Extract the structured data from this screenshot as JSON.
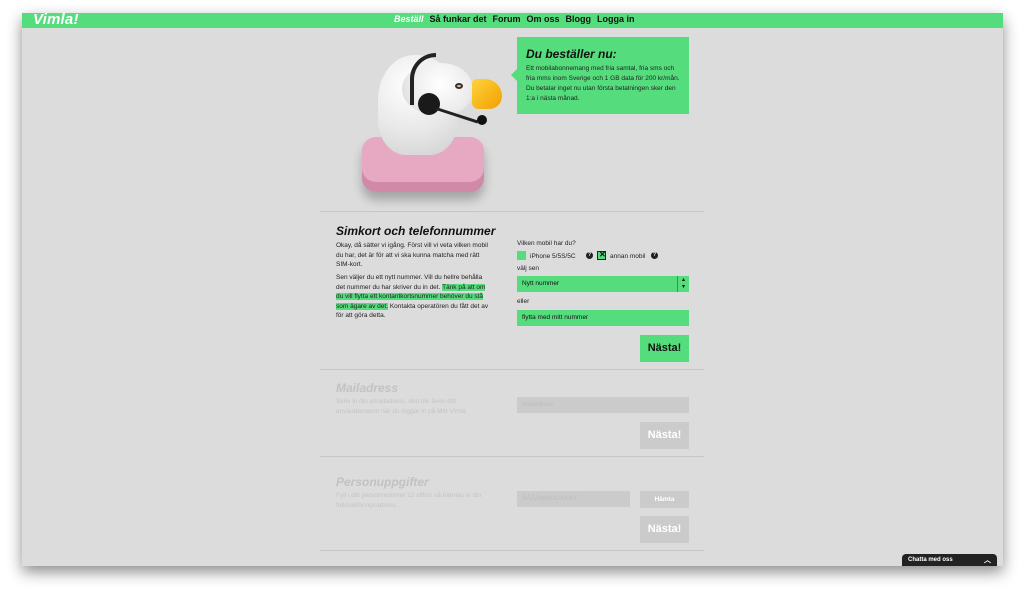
{
  "brand": {
    "logo": "Vimla!",
    "accent": "#55dd7d"
  },
  "nav": {
    "items": [
      "Beställ",
      "Så funkar det",
      "Forum",
      "Om oss",
      "Blogg",
      "Logga in"
    ],
    "active": "Beställ"
  },
  "bubble": {
    "title": "Du beställer nu:",
    "text": "Ett mobilabonnemang med fria samtal, fria sms och fria mms inom Sverige och 1 GB data för 200 kr/mån.  Du betalar inget nu utan första betalningen sker den 1:a i nästa månad."
  },
  "sim": {
    "title": "Simkort och telefonnummer",
    "para1": "Okay, då sätter vi igång. Först vill vi veta vilken mobil du har, det är för att vi ska kunna matcha med rätt SIM-kort.",
    "para2_before": "Sen väljer du ett nytt nummer. Vill du hellre behålla det nummer du har skriver du in det. ",
    "para2_highlight": "Tänk på att om du vill flytta ett kontantkortsnummer behöver du stå som ägare av det.",
    "para2_after": " Kontakta operatören du fått det av för att göra detta.",
    "phone_question": "Vilken mobil har du?",
    "option_iphone": "iPhone 5/5S/5C",
    "option_other": "annan mobil",
    "option_other_checked": true,
    "choose_label": "välj sen",
    "select_value": "Nytt nummer",
    "or_label": "eller",
    "move_placeholder": "flytta med mitt nummer",
    "next_button": "Nästa!"
  },
  "mail": {
    "title": "Mailadress",
    "text": "Skriv in din emailadress, den blir även ditt användarnamn när du loggar in på Mitt Vimla.",
    "placeholder": "Mailadress",
    "next_button": "Nästa!"
  },
  "personal": {
    "title": "Personuppgifter",
    "text": "Fyll i ditt personnummer 12 siffror så hämtas vi din folkbokföringsadress.",
    "placeholder": "ÅÅÅÅMMDDXXXX",
    "fetch_button": "Hämta",
    "next_button": "Nästa!"
  },
  "chat": {
    "label": "Chatta med oss"
  }
}
